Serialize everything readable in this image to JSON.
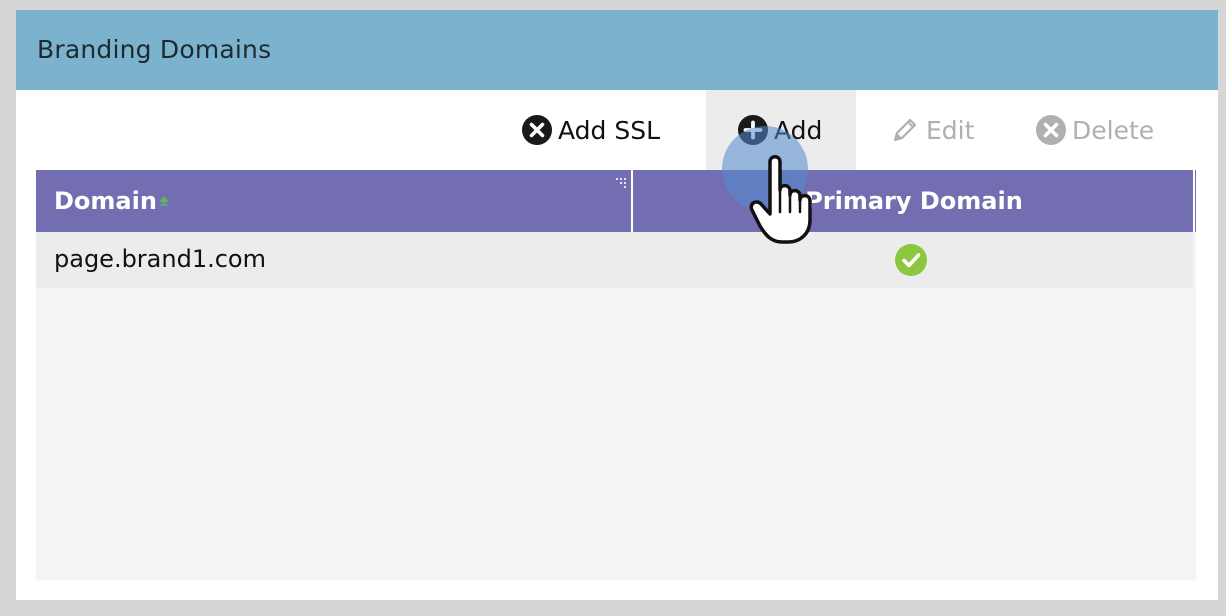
{
  "panel": {
    "title": "Branding Domains"
  },
  "toolbar": {
    "add_ssl": {
      "label": "Add SSL",
      "icon": "close-circle-icon",
      "enabled": true
    },
    "add": {
      "label": "Add",
      "icon": "plus-circle-icon",
      "enabled": true,
      "state": "pressed"
    },
    "edit": {
      "label": "Edit",
      "icon": "pencil-icon",
      "enabled": false
    },
    "delete": {
      "label": "Delete",
      "icon": "close-circle-icon",
      "enabled": false
    }
  },
  "grid": {
    "columns": [
      {
        "label": "Domain",
        "sort": "ascending"
      },
      {
        "label": "Primary Domain"
      }
    ],
    "rows": [
      {
        "domain": "page.brand1.com",
        "primary": true
      }
    ]
  },
  "colors": {
    "header_bg": "#7bb3cf",
    "grid_header_bg": "#736db2",
    "check_green": "#8dc63f",
    "disabled_text": "#b0b0b0"
  },
  "cursor": {
    "type": "hand-pointer"
  }
}
